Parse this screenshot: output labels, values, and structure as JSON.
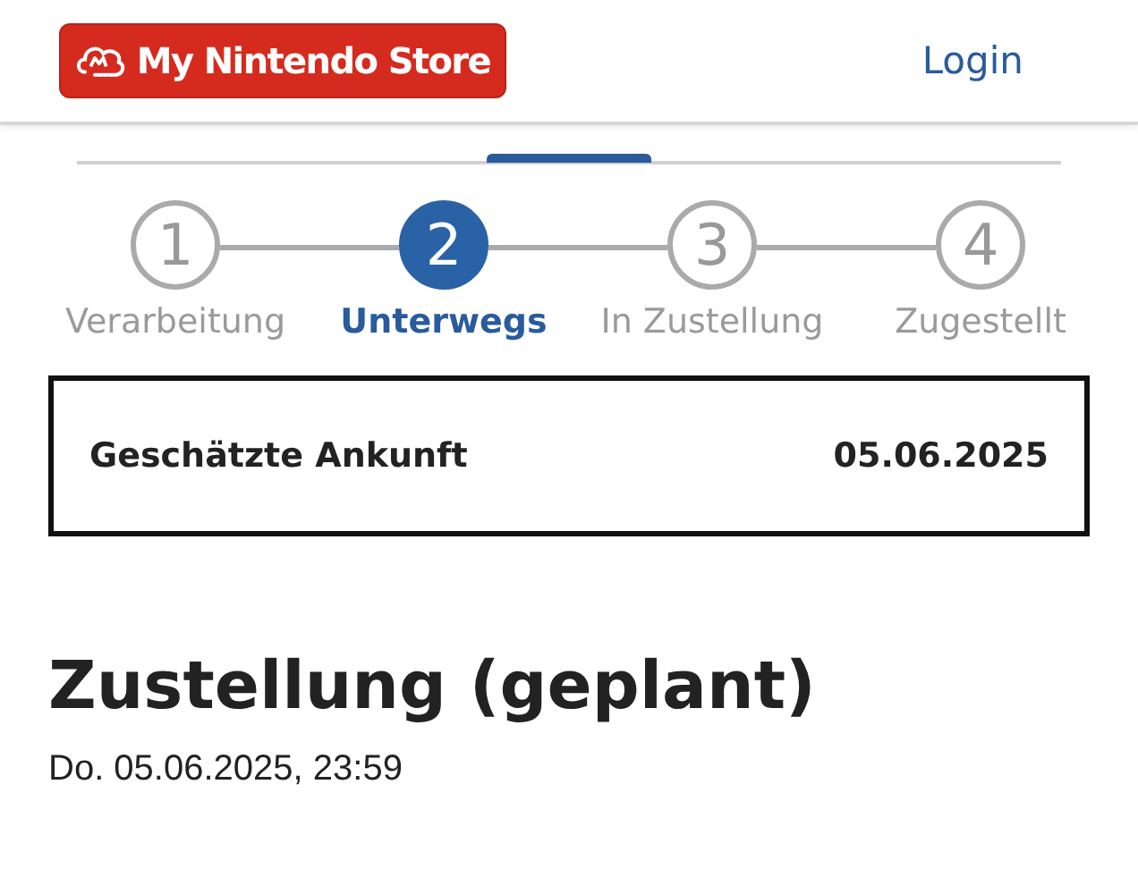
{
  "header": {
    "logo": "My Nintendo Store",
    "login": "Login"
  },
  "steps": [
    {
      "number": "1",
      "label": "Verarbeitung",
      "selected": false
    },
    {
      "number": "2",
      "label": "Unterwegs",
      "selected": true
    },
    {
      "number": "3",
      "label": "In Zustellung",
      "selected": false
    },
    {
      "number": "4",
      "label": "Zugestellt",
      "selected": false
    }
  ],
  "arrival": {
    "label": "Geschätzte Ankunft",
    "value": "05.06.2025"
  },
  "delivery": {
    "title": "Zustellung (geplant)",
    "datetime": "Do. 05.06.2025, 23:59"
  }
}
